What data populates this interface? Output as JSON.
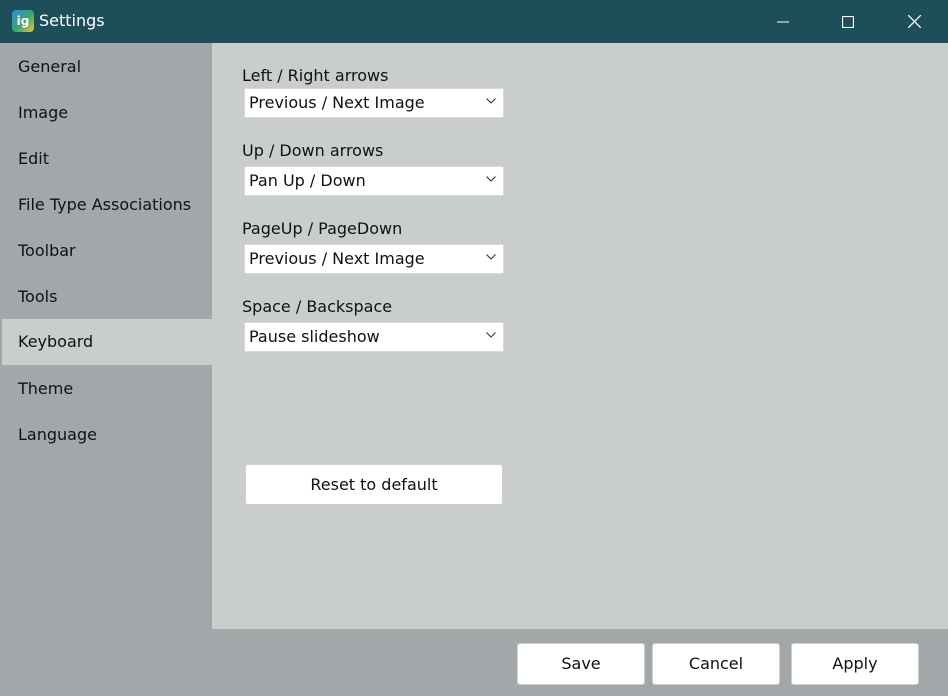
{
  "window": {
    "title": "Settings",
    "icon_text": "ig",
    "controls": {
      "minimize": "minimize-icon",
      "maximize": "maximize-icon",
      "close": "close-icon"
    }
  },
  "sidebar": {
    "items": [
      {
        "label": "General"
      },
      {
        "label": "Image"
      },
      {
        "label": "Edit"
      },
      {
        "label": "File Type Associations"
      },
      {
        "label": "Toolbar"
      },
      {
        "label": "Tools"
      },
      {
        "label": "Keyboard",
        "active": true
      },
      {
        "label": "Theme"
      },
      {
        "label": "Language"
      }
    ]
  },
  "keyboard": {
    "settings": [
      {
        "label": "Left / Right arrows",
        "value": "Previous / Next Image"
      },
      {
        "label": "Up / Down arrows",
        "value": "Pan Up / Down"
      },
      {
        "label": "PageUp / PageDown",
        "value": "Previous / Next Image"
      },
      {
        "label": "Space / Backspace",
        "value": "Pause slideshow"
      }
    ],
    "reset_label": "Reset to default"
  },
  "footer": {
    "save_label": "Save",
    "cancel_label": "Cancel",
    "apply_label": "Apply"
  },
  "colors": {
    "titlebar": "#1d4e5a",
    "sidebar": "#a2a8aa",
    "content": "#c9cecd",
    "active_item": "#c9cecd"
  }
}
